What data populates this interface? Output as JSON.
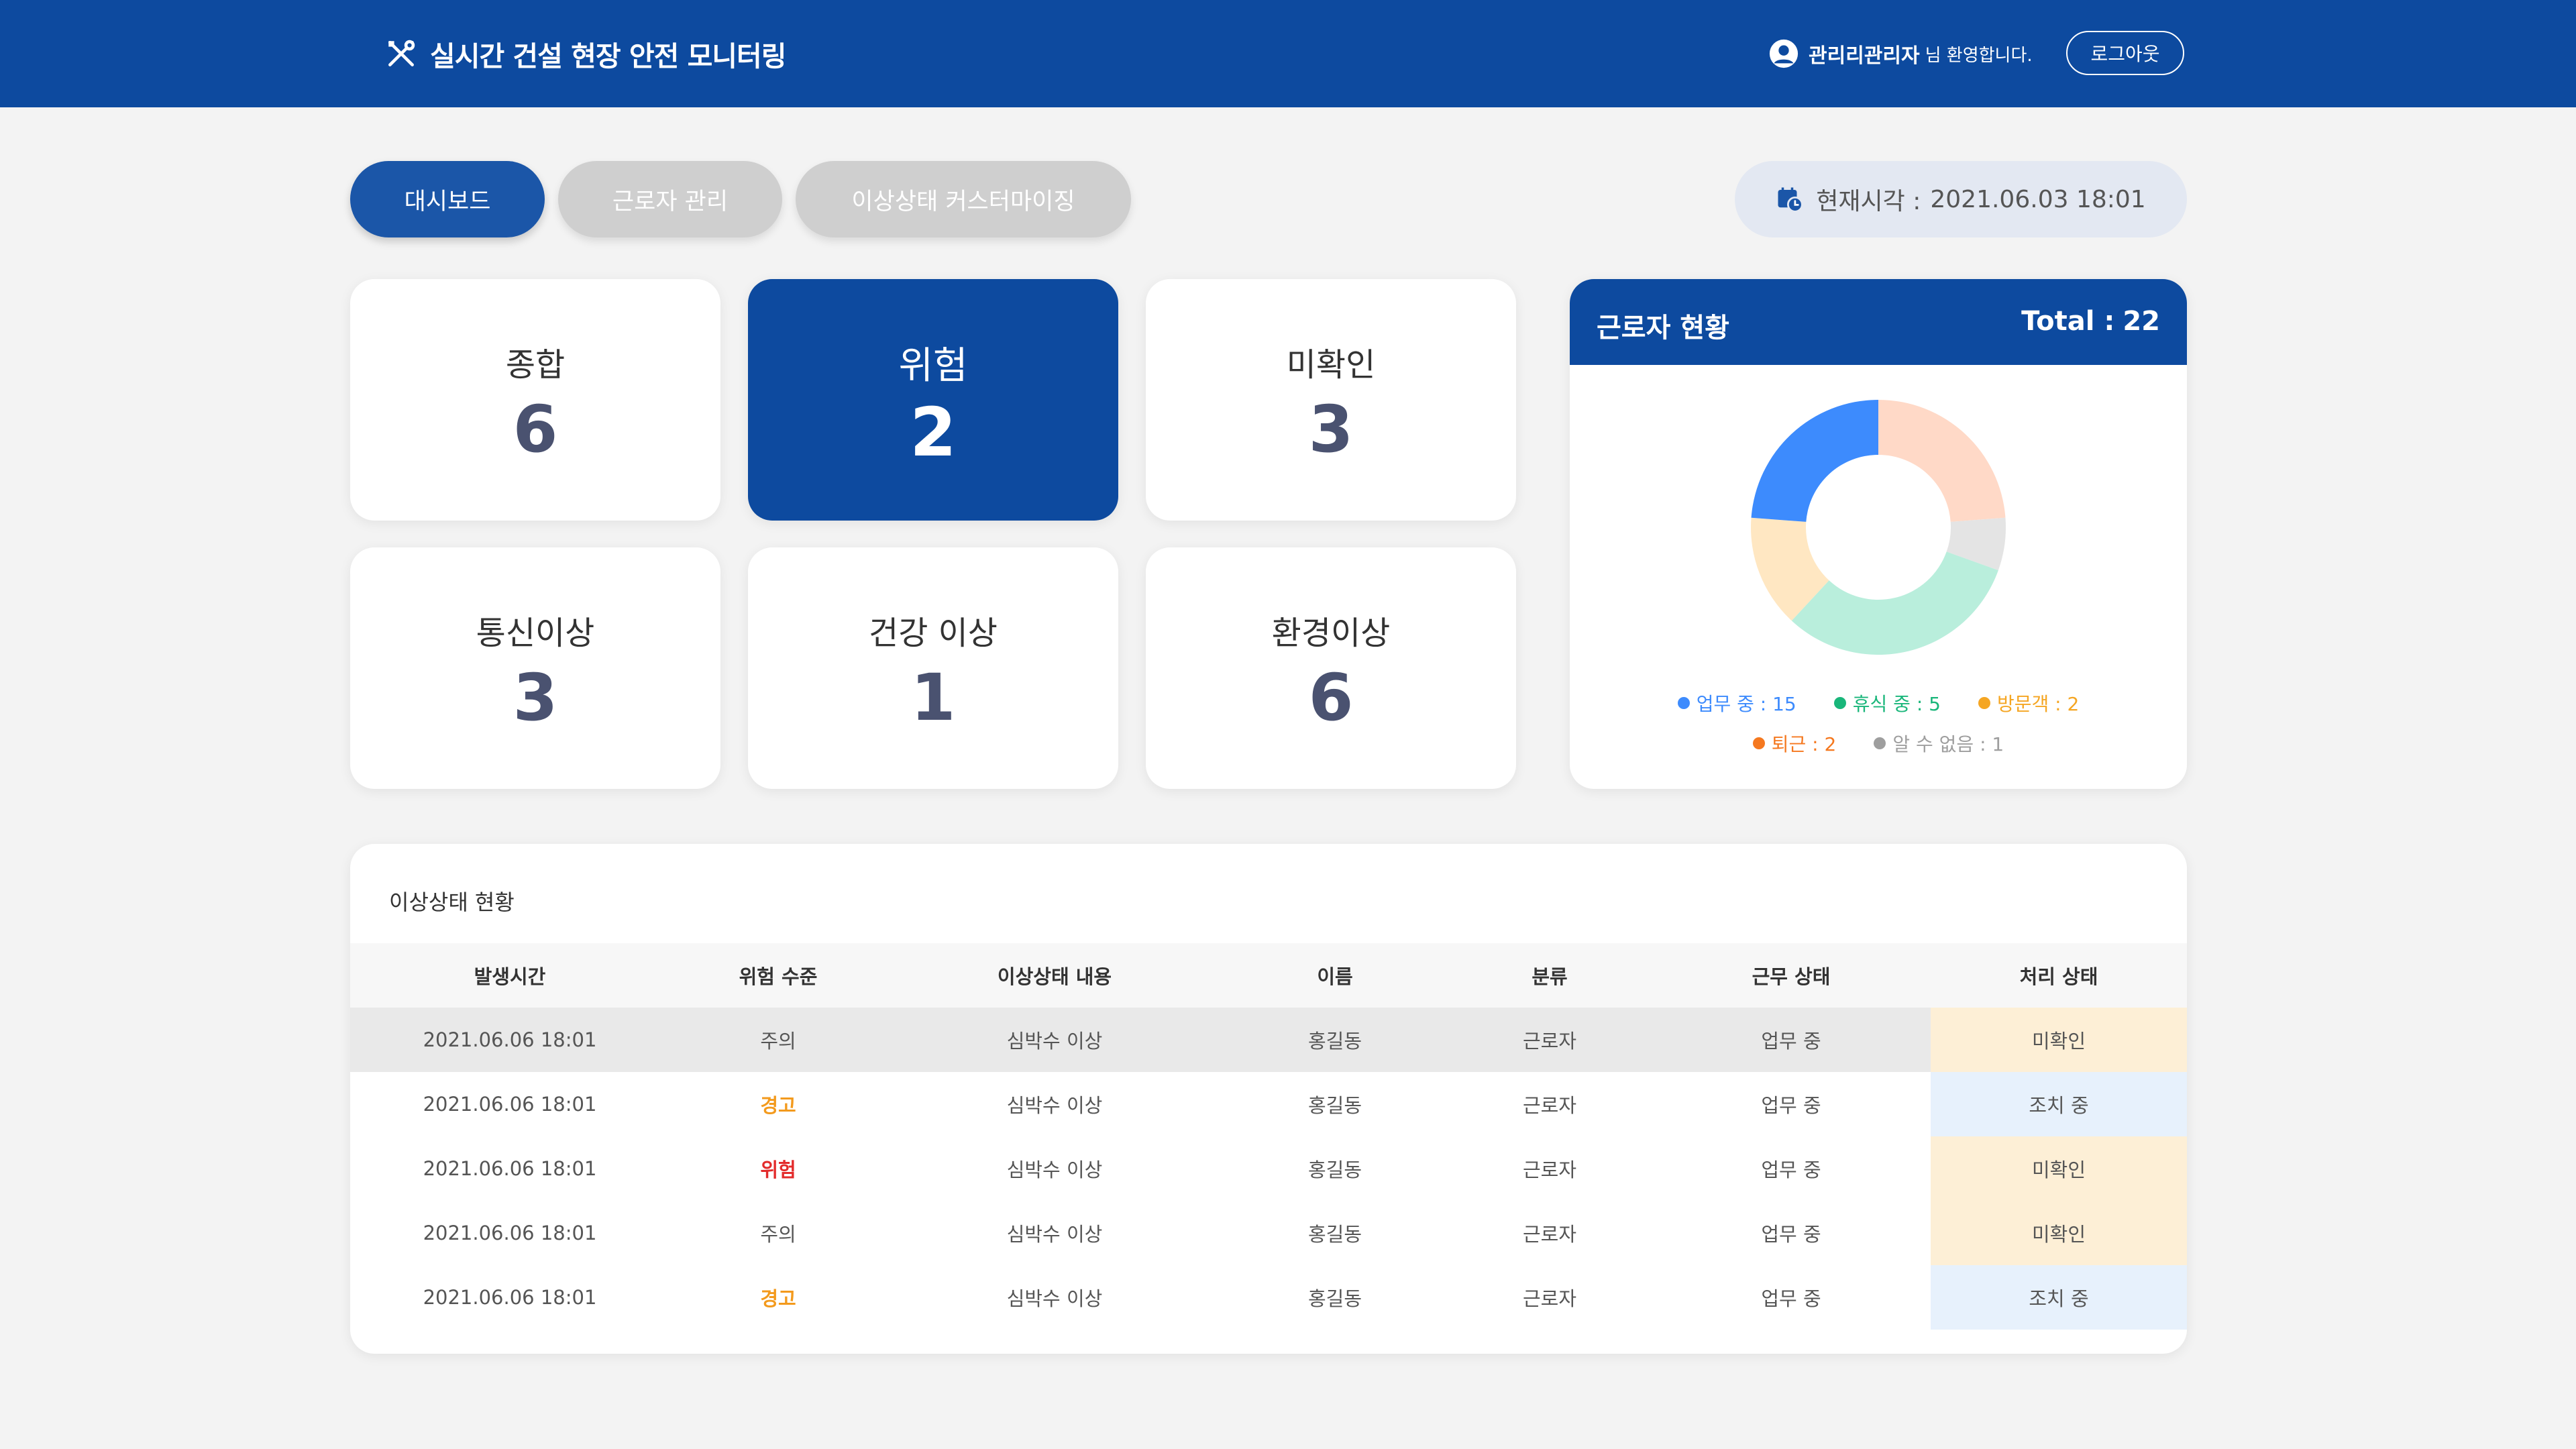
{
  "header": {
    "title": "실시간 건설 현장 안전 모니터링",
    "user_name": "관리리관리자",
    "user_suffix": "님 환영합니다.",
    "logout_label": "로그아웃",
    "brand_icon": "tools-icon",
    "user_icon": "user-icon"
  },
  "tabs": [
    {
      "label": "대시보드",
      "active": true
    },
    {
      "label": "근로자 관리",
      "active": false
    },
    {
      "label": "이상상태 커스터마이징",
      "active": false
    }
  ],
  "clock": {
    "label": "현재시각 :",
    "value": "2021.06.03 18:01",
    "icon": "calendar-clock-icon"
  },
  "stats": [
    {
      "label": "종합",
      "value": "6"
    },
    {
      "label": "위험",
      "value": "2",
      "highlight": true
    },
    {
      "label": "미확인",
      "value": "3"
    },
    {
      "label": "통신이상",
      "value": "3"
    },
    {
      "label": "건강 이상",
      "value": "1"
    },
    {
      "label": "환경이상",
      "value": "6"
    }
  ],
  "workers": {
    "title": "근로자 현황",
    "total_label": "Total :",
    "total_value": "22",
    "legend": [
      {
        "label": "업무 중 : 15",
        "color": "#3d8bfd"
      },
      {
        "label": "휴식 중 : 5",
        "color": "#19b67a"
      },
      {
        "label": "방문객 : 2",
        "color": "#f5a623"
      },
      {
        "label": "퇴근 : 2",
        "color": "#f5781f"
      },
      {
        "label": "알 수 없음 : 1",
        "color": "#9e9e9e"
      }
    ]
  },
  "chart_data": {
    "type": "pie",
    "donut": true,
    "categories": [
      "업무 중",
      "휴식 중",
      "방문객",
      "퇴근",
      "알 수 없음"
    ],
    "values": [
      15,
      5,
      2,
      2,
      1
    ],
    "colors": [
      "#3d8bfd",
      "#19b67a",
      "#f5a623",
      "#f5781f",
      "#9e9e9e"
    ],
    "slice_colors": [
      "#ffd9c7",
      "#e4e4e4",
      "#b9eedc",
      "#ffe7c2",
      "#3d8bfd"
    ],
    "slice_weights": [
      25,
      7,
      33,
      15,
      25
    ]
  },
  "alerts_table": {
    "title": "이상상태 현황",
    "columns": [
      "발생시간",
      "위험 수준",
      "이상상태 내용",
      "이름",
      "분류",
      "근무 상태",
      "처리 상태"
    ],
    "rows": [
      [
        "2021.06.06 18:01",
        "주의",
        "심박수 이상",
        "홍길동",
        "근로자",
        "업무 중",
        "미확인"
      ],
      [
        "2021.06.06 18:01",
        "경고",
        "심박수 이상",
        "홍길동",
        "근로자",
        "업무 중",
        "조치 중"
      ],
      [
        "2021.06.06 18:01",
        "위험",
        "심박수 이상",
        "홍길동",
        "근로자",
        "업무 중",
        "미확인"
      ],
      [
        "2021.06.06 18:01",
        "주의",
        "심박수 이상",
        "홍길동",
        "근로자",
        "업무 중",
        "미확인"
      ],
      [
        "2021.06.06 18:01",
        "경고",
        "심박수 이상",
        "홍길동",
        "근로자",
        "업무 중",
        "조치 중"
      ]
    ]
  }
}
